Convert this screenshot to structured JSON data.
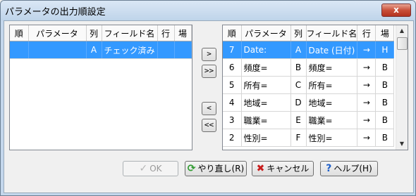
{
  "window": {
    "title": "パラメータの出力順設定",
    "close_label": "x"
  },
  "left_table": {
    "headers": [
      "順",
      "パラメータ",
      "列",
      "フィールド名",
      "行",
      "場"
    ],
    "rows": [
      {
        "order": "",
        "param": "",
        "col": "A",
        "field": "チェック済み",
        "row": "",
        "place": "",
        "selected": true
      }
    ]
  },
  "right_table": {
    "headers": [
      "順",
      "パラメータ",
      "列",
      "フィールド名",
      "行",
      "場"
    ],
    "rows": [
      {
        "order": "7",
        "param": "Date:",
        "col": "A",
        "field": "Date (日付)",
        "row": "→",
        "place": "H",
        "selected": true
      },
      {
        "order": "6",
        "param": "頻度=",
        "col": "B",
        "field": "頻度=",
        "row": "→",
        "place": "B"
      },
      {
        "order": "5",
        "param": "所有=",
        "col": "C",
        "field": "所有=",
        "row": "→",
        "place": "B"
      },
      {
        "order": "4",
        "param": "地域=",
        "col": "D",
        "field": "地域=",
        "row": "→",
        "place": "B"
      },
      {
        "order": "3",
        "param": "職業=",
        "col": "E",
        "field": "職業=",
        "row": "→",
        "place": "B"
      },
      {
        "order": "2",
        "param": "性別=",
        "col": "F",
        "field": "性別=",
        "row": "→",
        "place": "B"
      }
    ]
  },
  "move_buttons": {
    "move_right": ">",
    "move_all_right": ">>",
    "move_left": "<",
    "move_all_left": "<<"
  },
  "buttons": {
    "ok": "OK",
    "reset": "やり直し(R)",
    "cancel": "キャンセル",
    "help": "ヘルプ(H)"
  },
  "icons": {
    "ok": "check-icon",
    "reset": "refresh-icon",
    "cancel": "x-icon",
    "help": "question-icon"
  },
  "colors": {
    "selection": "#3399ff",
    "refresh": "#2e9a2e",
    "cancel": "#c81e1e",
    "help": "#1e5fc8"
  }
}
